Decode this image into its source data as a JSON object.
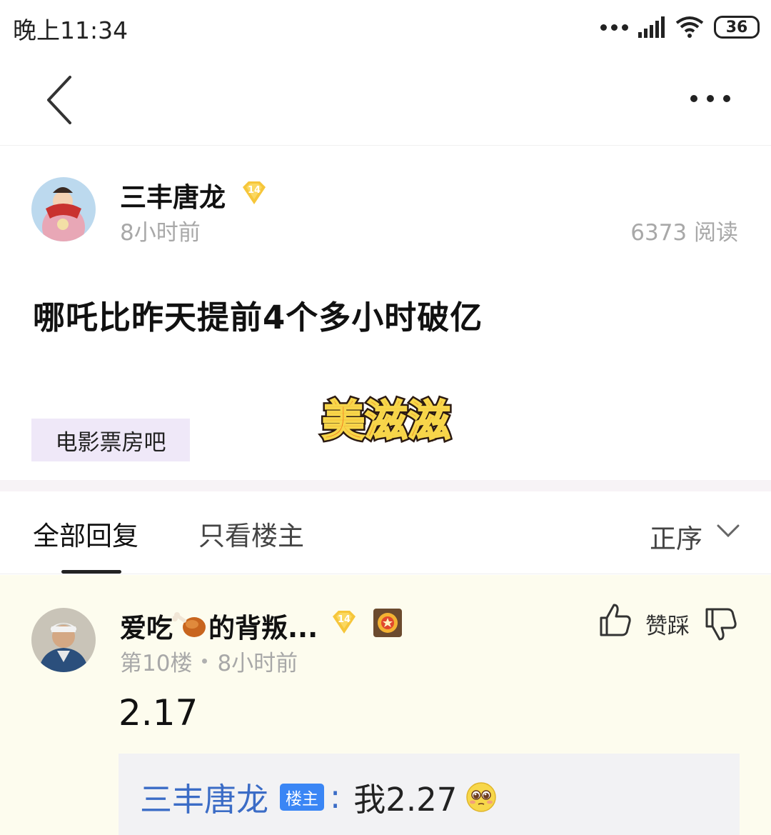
{
  "status_bar": {
    "time": "晚上11:34",
    "battery": "36"
  },
  "post": {
    "author": {
      "name": "三丰唐龙",
      "level": "14",
      "time": "8小时前"
    },
    "read_count": "6373 阅读",
    "title": "哪吒比昨天提前4个多小时破亿",
    "sticker_text": "美滋滋",
    "forum": "电影票房吧"
  },
  "tabs": {
    "all_replies": "全部回复",
    "owner_only": "只看楼主",
    "sort": "正序"
  },
  "reply": {
    "name_prefix": "爱吃",
    "name_suffix": "的背叛...",
    "level": "14",
    "floor": "第10楼",
    "time": "8小时前",
    "vote_label": "赞踩",
    "content": "2.17",
    "sub_reply": {
      "author": "三丰唐龙",
      "owner_badge": "楼主",
      "colon": ":",
      "text": "我2.27"
    }
  },
  "colors": {
    "accent_blue": "#3b6cc6",
    "owner_badge_bg": "#3a86f5",
    "level_badge": "#f6c63a",
    "reply_bg": "#fdfcee",
    "forum_tag_bg": "#efe8f8"
  }
}
